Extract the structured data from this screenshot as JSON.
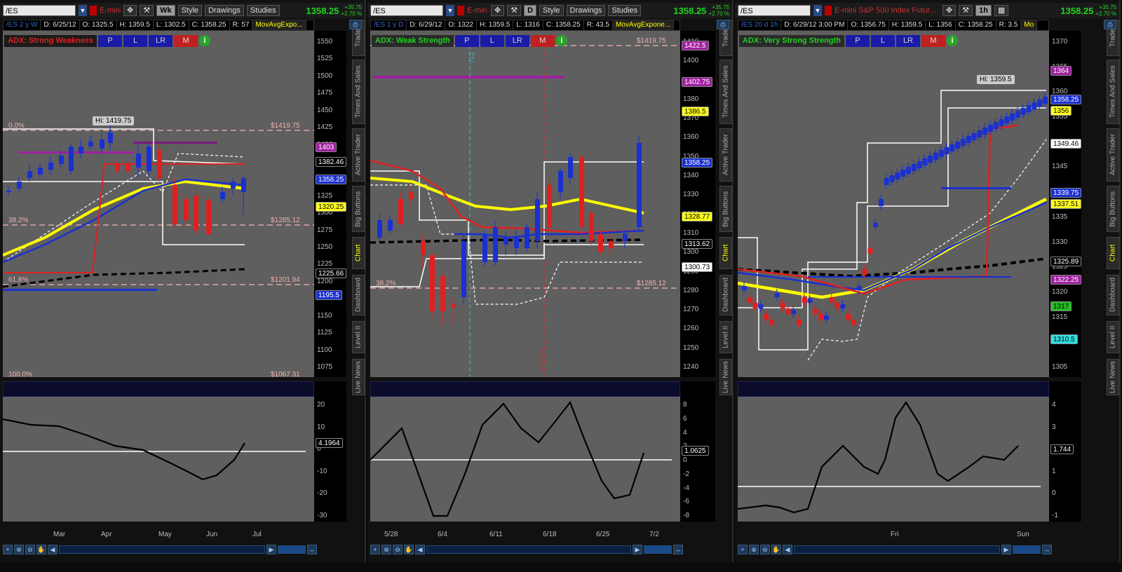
{
  "panels": [
    {
      "symbol": "/ES",
      "aggregation": "Wk",
      "desc_short": "E-mini",
      "style_label": "Style",
      "drawings_label": "Drawings",
      "studies_label": "Studies",
      "last_price": "1358.25",
      "change_pts": "+35.75",
      "change_pct": "+2.70 %",
      "info": {
        "symbol": "/ES 2 y W",
        "date": "D: 6/25/12",
        "open": "O: 1325.5",
        "high": "H: 1359.5",
        "low": "L: 1302.5",
        "close": "C: 1358.25",
        "range": "R: 57",
        "mavg": "MovAvgExpo..."
      },
      "adx": {
        "label": "ADX: Strong Weakness",
        "color": "#e02020",
        "bg": "#1b1b1b",
        "btn_p": "P",
        "btn_l": "L",
        "btn_lr": "LR",
        "btn_m": "M"
      },
      "y_ticks": [
        "1550",
        "1525",
        "1500",
        "1475",
        "1450",
        "1425",
        "1400",
        "1375",
        "1350",
        "1325",
        "1300",
        "1275",
        "1250",
        "1225",
        "1200",
        "1175",
        "1150",
        "1125",
        "1100",
        "1075"
      ],
      "price_tags": [
        {
          "text": "1403",
          "bg": "#a020a0",
          "fg": "#fff"
        },
        {
          "text": "1382.46",
          "bg": "#000",
          "fg": "#fff"
        },
        {
          "text": "1358.25",
          "bg": "#1a30d0",
          "fg": "#fff"
        },
        {
          "text": "1320.25",
          "bg": "#ffff20",
          "fg": "#000"
        },
        {
          "text": "1225.66",
          "bg": "#000",
          "fg": "#fff"
        },
        {
          "text": "1195.5",
          "bg": "#1a30d0",
          "fg": "#fff"
        }
      ],
      "fib": [
        {
          "pct": "0.0%",
          "price": "$1419.75"
        },
        {
          "pct": "38.2%",
          "price": "$1285.12"
        },
        {
          "pct": "61.8%",
          "price": "$1201.94"
        },
        {
          "pct": "100.0%",
          "price": "$1067.31"
        }
      ],
      "hi_label": "Hi: 1419.75",
      "osc_ticks": [
        "20",
        "10",
        "0",
        "-10",
        "-20",
        "-30"
      ],
      "osc_value": "4.1964",
      "x_labels": [
        "Mar",
        "Apr",
        "May",
        "Jun",
        "Jul"
      ]
    },
    {
      "symbol": "/ES",
      "aggregation": "D",
      "desc_short": "E-min",
      "style_label": "Style",
      "drawings_label": "Drawings",
      "studies_label": "Studies",
      "last_price": "1358.25",
      "change_pts": "+35.75",
      "change_pct": "+2.70 %",
      "info": {
        "symbol": "/ES 1 y D",
        "date": "D: 6/29/12",
        "open": "O: 1322",
        "high": "H: 1359.5",
        "low": "L: 1316",
        "close": "C: 1358.25",
        "range": "R: 43.5",
        "mavg": "MovAvgExpone..."
      },
      "adx": {
        "label": "ADX: Weak Strength",
        "color": "#20d020",
        "bg": "#2a2a2a",
        "btn_p": "P",
        "btn_l": "L",
        "btn_lr": "LR",
        "btn_m": "M"
      },
      "y_ticks": [
        "1410",
        "1400",
        "1390",
        "1380",
        "1370",
        "1360",
        "1350",
        "1340",
        "1330",
        "1320",
        "1310",
        "1300",
        "1290",
        "1280",
        "1270",
        "1260",
        "1250",
        "1240"
      ],
      "price_tags": [
        {
          "text": "1422.5",
          "bg": "#a020a0",
          "fg": "#fff"
        },
        {
          "text": "1402.75",
          "bg": "#a020a0",
          "fg": "#fff"
        },
        {
          "text": "1386.5",
          "bg": "#ffff20",
          "fg": "#000"
        },
        {
          "text": "1358.25",
          "bg": "#1a30d0",
          "fg": "#fff"
        },
        {
          "text": "1328.77",
          "bg": "#ffff20",
          "fg": "#000"
        },
        {
          "text": "1313.62",
          "bg": "#000",
          "fg": "#fff"
        },
        {
          "text": "1300.73",
          "bg": "#fff",
          "fg": "#000"
        }
      ],
      "fib": [
        {
          "pct": "",
          "price": "$1419.75"
        },
        {
          "pct": "38.2%",
          "price": "$1285.12"
        }
      ],
      "vline_labels": [
        "6/15/12",
        "/12"
      ],
      "osc_ticks": [
        "8",
        "6",
        "4",
        "2",
        "0",
        "-2",
        "-4",
        "-6",
        "-8"
      ],
      "osc_value": "1.0625",
      "x_labels": [
        "5/28",
        "6/4",
        "6/11",
        "6/18",
        "6/25",
        "7/2"
      ]
    },
    {
      "symbol": "/ES",
      "aggregation": "1h",
      "desc_short": "E-mini S&P 500 Index Futur...",
      "last_price": "1358.25",
      "change_pts": "+35.75",
      "change_pct": "+2.70 %",
      "info": {
        "symbol": "/ES 20 d 1h",
        "date": "D: 6/29/12 3:00 PM",
        "open": "O: 1356.75",
        "high": "H: 1359.5",
        "low": "L: 1356",
        "close": "C: 1358.25",
        "range": "R: 3.5",
        "mavg": "Mo"
      },
      "adx": {
        "label": "ADX: Very Strong Strength",
        "color": "#20d020",
        "bg": "#2a2a2a",
        "btn_p": "P",
        "btn_l": "L",
        "btn_lr": "LR",
        "btn_m": "M"
      },
      "y_ticks": [
        "1370",
        "1365",
        "1360",
        "1355",
        "1350",
        "1345",
        "1340",
        "1335",
        "1330",
        "1325",
        "1320",
        "1315",
        "1310",
        "1305"
      ],
      "price_tags": [
        {
          "text": "1364",
          "bg": "#a020a0",
          "fg": "#fff"
        },
        {
          "text": "1358.25",
          "bg": "#1a30d0",
          "fg": "#fff"
        },
        {
          "text": "1356",
          "bg": "#ffff20",
          "fg": "#000"
        },
        {
          "text": "1349.46",
          "bg": "#fff",
          "fg": "#000"
        },
        {
          "text": "1339.75",
          "bg": "#1a30d0",
          "fg": "#fff"
        },
        {
          "text": "1337.51",
          "bg": "#ffff20",
          "fg": "#000"
        },
        {
          "text": "1325.89",
          "bg": "#000",
          "fg": "#fff"
        },
        {
          "text": "1322.25",
          "bg": "#a020a0",
          "fg": "#fff"
        },
        {
          "text": "1317",
          "bg": "#20c020",
          "fg": "#000"
        },
        {
          "text": "1310.5",
          "bg": "#30e0e0",
          "fg": "#000"
        }
      ],
      "hi_label": "Hi: 1359.5",
      "osc_ticks": [
        "4",
        "3",
        "2",
        "1",
        "0",
        "-1"
      ],
      "osc_value": "1.744",
      "x_labels": [
        "Fri",
        "Sun"
      ]
    }
  ],
  "side_tabs": [
    "Trade",
    "Times And Sales",
    "Active Trader",
    "Big Buttons",
    "Chart",
    "Dashboard",
    "Level II",
    "Live News"
  ]
}
